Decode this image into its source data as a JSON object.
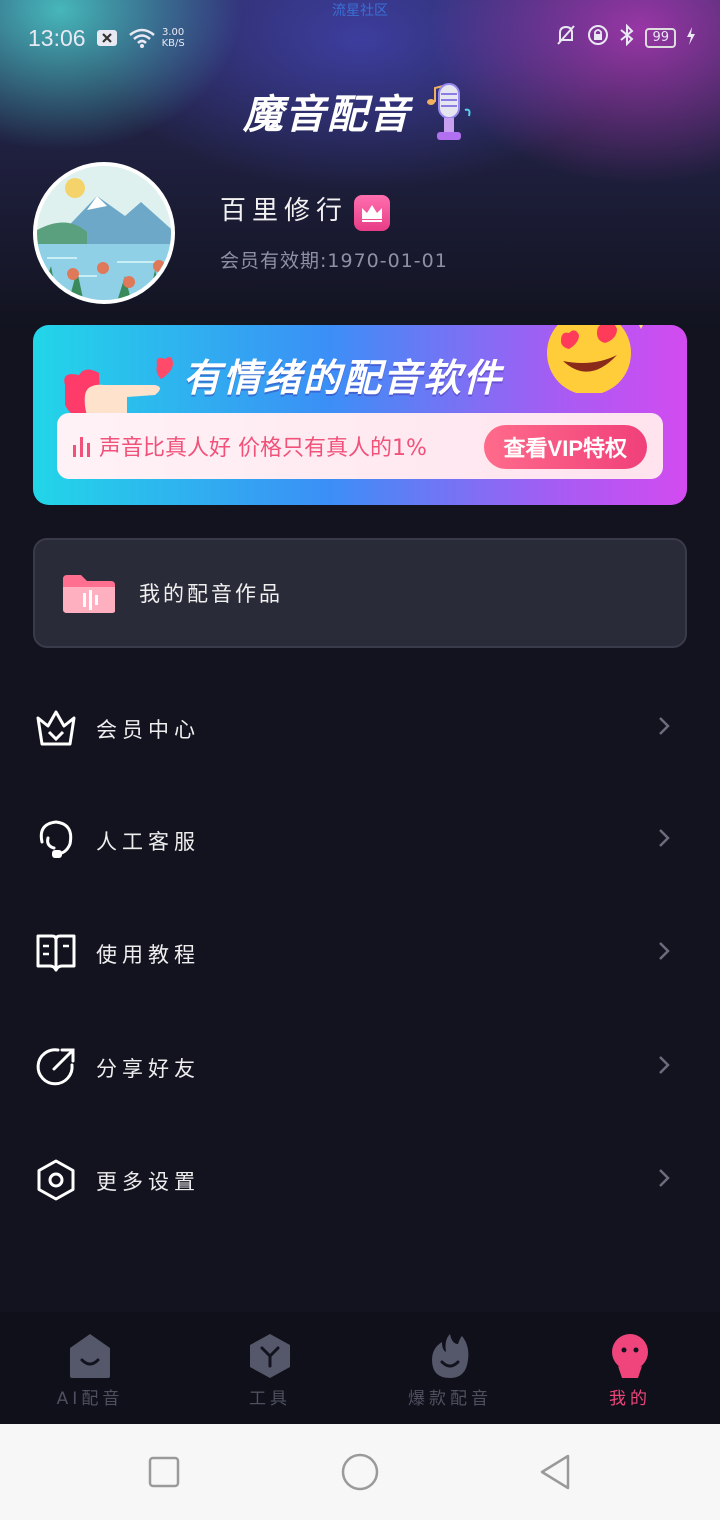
{
  "status_bar": {
    "watermark": "流星社区",
    "time": "13:06",
    "net_speed_value": "3.00",
    "net_speed_unit": "KB/S",
    "battery": "99"
  },
  "header": {
    "app_title": "魔音配音"
  },
  "profile": {
    "username": "百里修行",
    "expiry": "会员有效期:1970-01-01"
  },
  "vip_banner": {
    "headline": "有情绪的配音软件",
    "slogan": "声音比真人好 价格只有真人的1%",
    "button_label": "查看VIP特权"
  },
  "works": {
    "label": "我的配音作品"
  },
  "menu": [
    {
      "label": "会员中心",
      "icon": "crown-icon"
    },
    {
      "label": "人工客服",
      "icon": "headset-icon"
    },
    {
      "label": "使用教程",
      "icon": "book-icon"
    },
    {
      "label": "分享好友",
      "icon": "share-icon"
    },
    {
      "label": "更多设置",
      "icon": "settings-icon"
    }
  ],
  "tabs": [
    {
      "label": "AI配音",
      "icon": "home-smile-icon",
      "active": false
    },
    {
      "label": "工具",
      "icon": "tools-cube-icon",
      "active": false
    },
    {
      "label": "爆款配音",
      "icon": "flame-icon",
      "active": false
    },
    {
      "label": "我的",
      "icon": "profile-face-icon",
      "active": true
    }
  ],
  "colors": {
    "background": "#12131f",
    "accent_pink": "#f0457c",
    "inactive_tab": "#4e5060"
  }
}
